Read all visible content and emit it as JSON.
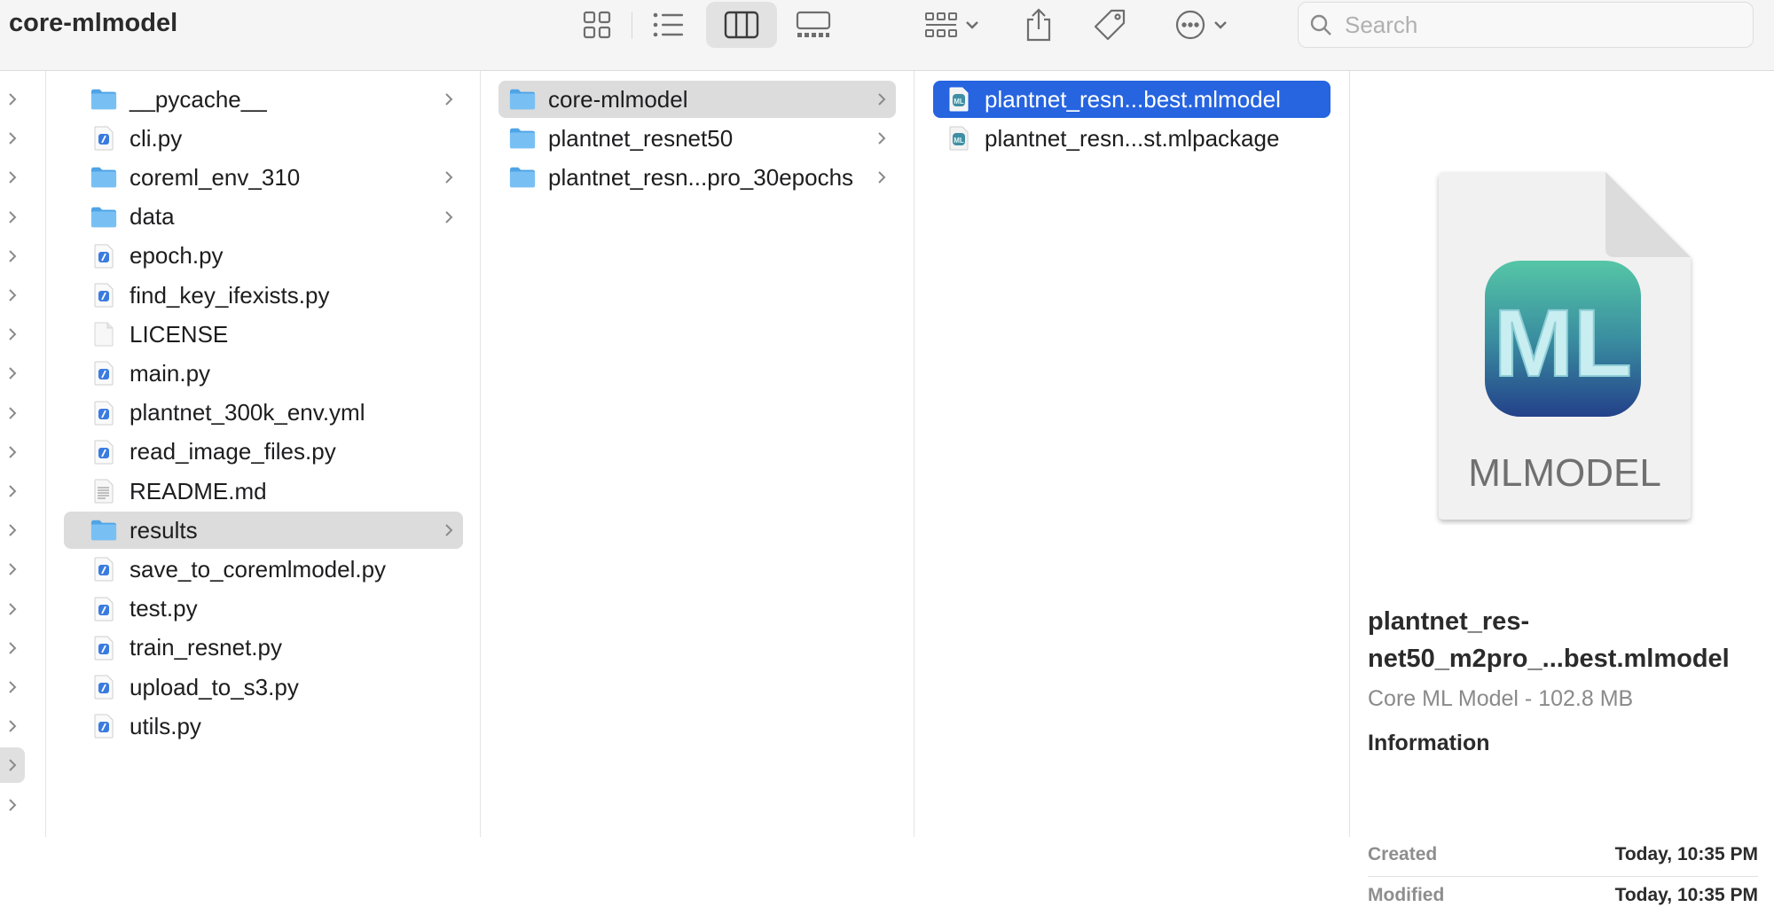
{
  "window": {
    "title": "core-mlmodel"
  },
  "toolbar": {
    "view_icons": "icon-view-icon",
    "view_list": "list-view-icon",
    "view_columns": "column-view-icon",
    "view_gallery": "gallery-view-icon",
    "group": "group-icon",
    "share": "share-icon",
    "tags": "tag-icon",
    "more": "more-icon"
  },
  "search": {
    "placeholder": "Search",
    "value": ""
  },
  "column1": {
    "items": [
      {
        "label": "__pycache__",
        "type": "folder"
      },
      {
        "label": "cli.py",
        "type": "py"
      },
      {
        "label": "coreml_env_310",
        "type": "folder"
      },
      {
        "label": "data",
        "type": "folder"
      },
      {
        "label": "epoch.py",
        "type": "py"
      },
      {
        "label": "find_key_ifexists.py",
        "type": "py"
      },
      {
        "label": "LICENSE",
        "type": "blank"
      },
      {
        "label": "main.py",
        "type": "py"
      },
      {
        "label": "plantnet_300k_env.yml",
        "type": "py"
      },
      {
        "label": "read_image_files.py",
        "type": "py"
      },
      {
        "label": "README.md",
        "type": "text"
      },
      {
        "label": "results",
        "type": "folder"
      },
      {
        "label": "save_to_coremlmodel.py",
        "type": "py"
      },
      {
        "label": "test.py",
        "type": "py"
      },
      {
        "label": "train_resnet.py",
        "type": "py"
      },
      {
        "label": "upload_to_s3.py",
        "type": "py"
      },
      {
        "label": "utils.py",
        "type": "py"
      }
    ]
  },
  "column2": {
    "items": [
      {
        "label": "core-mlmodel",
        "type": "folder"
      },
      {
        "label": "plantnet_resnet50",
        "type": "folder"
      },
      {
        "label": "plantnet_resn...pro_30epochs",
        "type": "folder"
      }
    ]
  },
  "column3": {
    "items": [
      {
        "label": "plantnet_resn...best.mlmodel",
        "type": "mlmodel"
      },
      {
        "label": "plantnet_resn...st.mlpackage",
        "type": "mlmodel"
      }
    ]
  },
  "preview": {
    "icon_label": "MLMODEL",
    "icon_glyph": "ML",
    "filename": "plantnet_res-net50_m2pro_...best.mlmodel",
    "kind": "Core ML Model - 102.8 MB",
    "info_heading": "Information",
    "created_label": "Created",
    "created_value": "Today, 10:35 PM",
    "modified_label": "Modified",
    "modified_value": "Today, 10:35 PM"
  },
  "colors": {
    "selection": "#2664e0",
    "folder": "#5fb0ee",
    "inactive_selection": "#dcdcdc"
  }
}
